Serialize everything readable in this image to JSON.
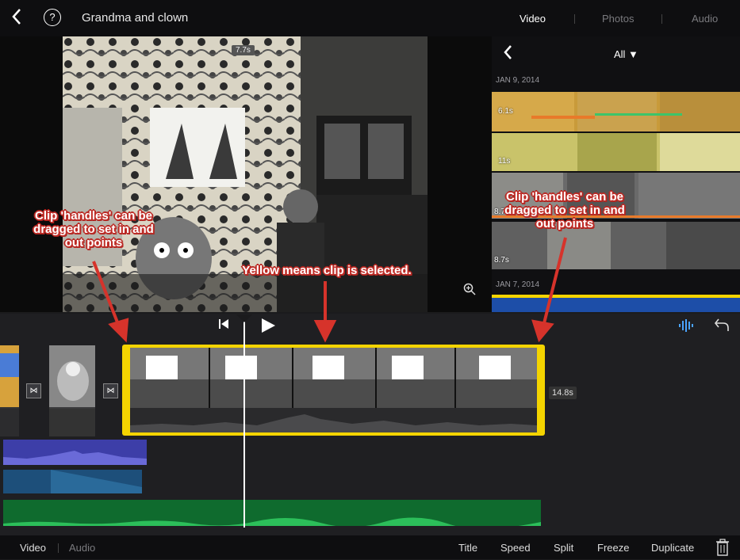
{
  "header": {
    "back_glyph": "‹",
    "help_glyph": "?",
    "title": "Grandma and clown",
    "tabs": [
      "Video",
      "Photos",
      "Audio"
    ]
  },
  "viewer": {
    "clip_time": "7.7s",
    "zoom_icon": "magnifier-plus-icon"
  },
  "browser": {
    "filter": "All ▼",
    "groups": [
      {
        "date": "JAN 9, 2014",
        "durations": [
          "6.1s",
          "11s",
          "8.7s",
          "8.7s"
        ]
      },
      {
        "date": "JAN 7, 2014"
      }
    ]
  },
  "timeline": {
    "selected_clip_duration": "14.8s",
    "transition_glyph": "⋈"
  },
  "toolbar": {
    "tabs": [
      "Video",
      "Audio"
    ],
    "actions": [
      "Title",
      "Speed",
      "Split",
      "Freeze",
      "Duplicate"
    ]
  },
  "annotations": {
    "handles_left": "Clip 'handles' can be dragged to set in and out points",
    "handles_right": "Clip 'handles' can be dragged to set in and out points",
    "selected": "Yellow means clip is selected."
  },
  "colors": {
    "selection": "#f4d400",
    "annotation_red": "#d6332b",
    "audio_blue": "#4aa3ff",
    "track_purple": "#3d3ea8",
    "track_green": "#0f6b2e"
  }
}
